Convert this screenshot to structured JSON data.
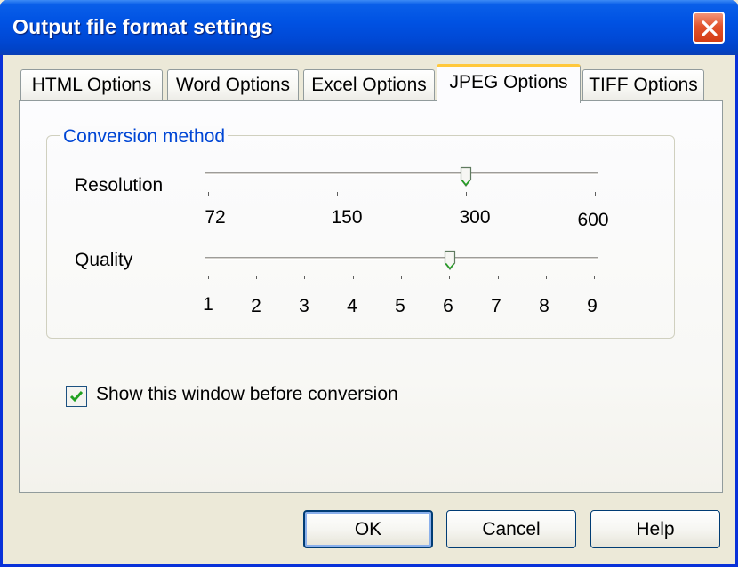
{
  "window": {
    "title": "Output file format settings",
    "close_icon": "close-icon",
    "accent_color": "#0052e3",
    "close_color": "#e2532c"
  },
  "tabs": [
    {
      "label": "HTML Options",
      "active": false
    },
    {
      "label": "Word Options",
      "active": false
    },
    {
      "label": "Excel Options",
      "active": false
    },
    {
      "label": "JPEG Options",
      "active": true
    },
    {
      "label": "TIFF Options",
      "active": false
    }
  ],
  "conversion": {
    "group_label": "Conversion method",
    "resolution": {
      "label": "Resolution",
      "ticks": [
        "72",
        "150",
        "300",
        "600"
      ],
      "selected": "300"
    },
    "quality": {
      "label": "Quality",
      "ticks": [
        "1",
        "2",
        "3",
        "4",
        "5",
        "6",
        "7",
        "8",
        "9"
      ],
      "selected": "6"
    }
  },
  "options": {
    "show_window_label": "Show this window before conversion",
    "show_window_checked": true,
    "check_color": "#21a121"
  },
  "buttons": {
    "ok": "OK",
    "cancel": "Cancel",
    "help": "Help"
  }
}
